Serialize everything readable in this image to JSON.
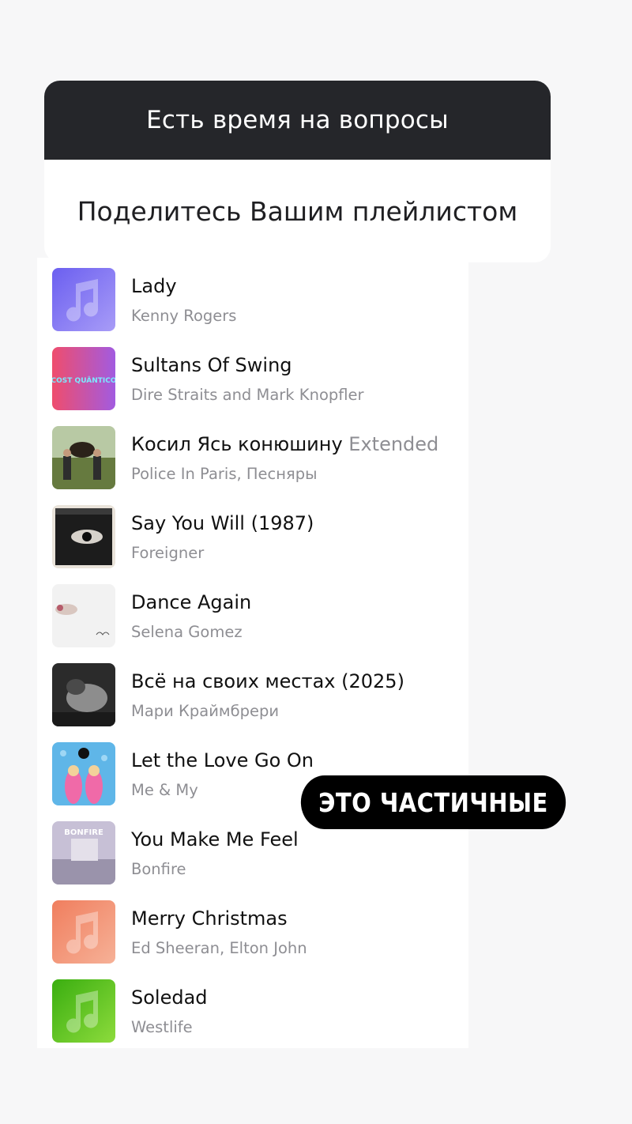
{
  "question_card": {
    "header": "Есть время на вопросы",
    "prompt": "Поделитесь Вашим плейлистом"
  },
  "playlist": [
    {
      "title": "Lady",
      "extra": "",
      "artist": "Kenny Rogers",
      "cover_icon": "music-note-placeholder-icon",
      "cover_color": "#7b6ff0"
    },
    {
      "title": "Sultans Of Swing",
      "extra": "",
      "artist": "Dire Straits and Mark Knopfler",
      "cover_text": "COST QUÂNTICO",
      "cover_color": "#e2507a"
    },
    {
      "title": "Косил Ясь конюшину",
      "extra": "Extended",
      "artist": "Police In Paris, Песняры",
      "cover_icon": "band-photo-cover",
      "cover_color": "#6f7a55"
    },
    {
      "title": "Say You Will (1987)",
      "extra": "",
      "artist": "Foreigner",
      "cover_icon": "eye-photo-cover",
      "cover_color": "#2a2a2a"
    },
    {
      "title": "Dance Again",
      "extra": "",
      "artist": "Selena Gomez",
      "cover_icon": "portrait-photo-cover",
      "cover_color": "#f1f1f1"
    },
    {
      "title": "Всё на своих местах (2025)",
      "extra": "",
      "artist": "Мари Краймбрери",
      "cover_icon": "bw-photo-cover",
      "cover_color": "#3a3a3a"
    },
    {
      "title": "Let the Love Go On",
      "extra": "",
      "artist": "Me & My",
      "cover_icon": "duo-photo-cover",
      "cover_color": "#59b7e6"
    },
    {
      "title": "You Make Me Feel",
      "extra": "",
      "artist": "Bonfire",
      "cover_text": "BONFIRE",
      "cover_color": "#b8b0c8"
    },
    {
      "title": "Merry Christmas",
      "extra": "",
      "artist": "Ed Sheeran, Elton John",
      "cover_icon": "music-note-placeholder-icon",
      "cover_color": "#f08b6a"
    },
    {
      "title": "Soledad",
      "extra": "",
      "artist": "Westlife",
      "cover_icon": "music-note-placeholder-icon",
      "cover_color": "#4cb81c"
    }
  ],
  "caption": "ЭТО ЧАСТИЧНЫЕ"
}
